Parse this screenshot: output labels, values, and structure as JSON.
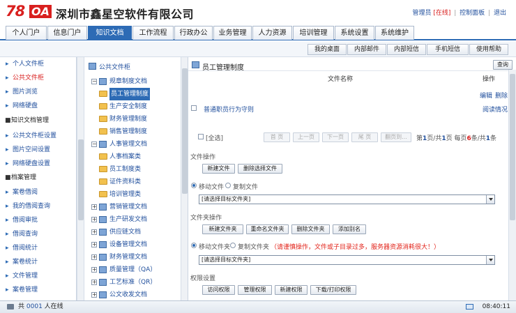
{
  "header": {
    "logo_num": "78",
    "logo_oa": "OA",
    "company": "深圳市鑫星空软件有限公司",
    "user_role": "管理员",
    "online_status": "[在线]",
    "control_panel": "控制面板",
    "logout": "退出"
  },
  "nav": {
    "tabs": [
      "个人门户",
      "信息门户",
      "知识文档",
      "工作流程",
      "行政办公",
      "业务管理",
      "人力资源",
      "培训管理",
      "系统设置",
      "系统维护"
    ],
    "active": "知识文档"
  },
  "subbar": {
    "buttons": [
      "我的桌面",
      "内部邮件",
      "内部短信",
      "手机短信",
      "使用帮助"
    ]
  },
  "left_menu": {
    "items": [
      {
        "label": "个人文件柜",
        "type": "item"
      },
      {
        "label": "公共文件柜",
        "type": "active"
      },
      {
        "label": "图片浏览",
        "type": "item"
      },
      {
        "label": "网络硬盘",
        "type": "item"
      },
      {
        "label": "知识文档管理",
        "type": "head"
      },
      {
        "label": "公共文件柜设置",
        "type": "item"
      },
      {
        "label": "图片空间设置",
        "type": "item"
      },
      {
        "label": "网络硬盘设置",
        "type": "item"
      },
      {
        "label": "档案管理",
        "type": "head"
      },
      {
        "label": "案卷借阅",
        "type": "item"
      },
      {
        "label": "我的借阅查询",
        "type": "item"
      },
      {
        "label": "借阅审批",
        "type": "item"
      },
      {
        "label": "借阅查询",
        "type": "item"
      },
      {
        "label": "借阅统计",
        "type": "item"
      },
      {
        "label": "案卷统计",
        "type": "item"
      },
      {
        "label": "文件管理",
        "type": "item"
      },
      {
        "label": "案卷管理",
        "type": "item"
      }
    ]
  },
  "tree": {
    "root": "公共文件柜",
    "nodes": [
      {
        "label": "规章制度文档",
        "level": 1,
        "kind": "doc",
        "expander": "−"
      },
      {
        "label": "员工管理制度",
        "level": 2,
        "kind": "folder",
        "selected": true
      },
      {
        "label": "生产安全制度",
        "level": 2,
        "kind": "folder"
      },
      {
        "label": "财务管理制度",
        "level": 2,
        "kind": "folder"
      },
      {
        "label": "销售管理制度",
        "level": 2,
        "kind": "folder"
      },
      {
        "label": "人事管理文档",
        "level": 1,
        "kind": "doc",
        "expander": "−"
      },
      {
        "label": "人事档案类",
        "level": 2,
        "kind": "folder"
      },
      {
        "label": "员工制度类",
        "level": 2,
        "kind": "folder"
      },
      {
        "label": "证件资料类",
        "level": 2,
        "kind": "folder"
      },
      {
        "label": "培训管理类",
        "level": 2,
        "kind": "folder"
      },
      {
        "label": "营销管理文档",
        "level": 1,
        "kind": "doc",
        "expander": "+"
      },
      {
        "label": "生产研发文档",
        "level": 1,
        "kind": "doc",
        "expander": "+"
      },
      {
        "label": "供应链文档",
        "level": 1,
        "kind": "doc",
        "expander": "+"
      },
      {
        "label": "设备管理文档",
        "level": 1,
        "kind": "doc",
        "expander": "+"
      },
      {
        "label": "财务管理文档",
        "level": 1,
        "kind": "doc",
        "expander": "+"
      },
      {
        "label": "质量管理（QA）",
        "level": 1,
        "kind": "doc",
        "expander": "+"
      },
      {
        "label": "工艺标准（QR）",
        "level": 1,
        "kind": "doc",
        "expander": "+"
      },
      {
        "label": "公文收发文档",
        "level": 1,
        "kind": "doc",
        "expander": "+"
      }
    ]
  },
  "main": {
    "title": "员工管理制度",
    "search_button": "查询",
    "col_filename": "文件名称",
    "col_action": "操作",
    "file": {
      "name": "普通职员行为守则",
      "edit": "编辑",
      "delete": "删除",
      "read_status": "阅读情况"
    },
    "select_all": "[全选]",
    "pager_buttons": [
      "首 页",
      "上一页",
      "下一页",
      "尾 页",
      "翻页到..."
    ],
    "pager_text": {
      "p1": "第",
      "page": "1",
      "p2": "页/共",
      "total_pages": "1",
      "p3": "页 每页",
      "per_page": "6",
      "p4": "条/共",
      "total": "1",
      "p5": "条"
    },
    "file_ops_label": "文件操作",
    "file_ops_buttons": [
      "新建文件",
      "删除选择文件"
    ],
    "move_file": "移动文件",
    "copy_file": "复制文件",
    "select_placeholder_1": "[请选择目标文件夹]",
    "folder_ops_label": "文件夹操作",
    "folder_ops_buttons": [
      "新建文件夹",
      "重命名文件夹",
      "删除文件夹",
      "添加别名"
    ],
    "move_folder": "移动文件夹",
    "copy_folder": "复制文件夹",
    "warning": "请谨慎操作，文件或子目录过多，服务器资源消耗很大！）",
    "warning_open": "（",
    "select_placeholder_2": "[请选择目标文件夹]",
    "perm_label": "权限设置",
    "perm_buttons": [
      "访问权限",
      "管理权限",
      "新建权限",
      "下载/打印权限"
    ]
  },
  "status": {
    "online_prefix": "共",
    "online_count": "0001",
    "online_suffix": "人在线",
    "time": "08:40:11"
  }
}
